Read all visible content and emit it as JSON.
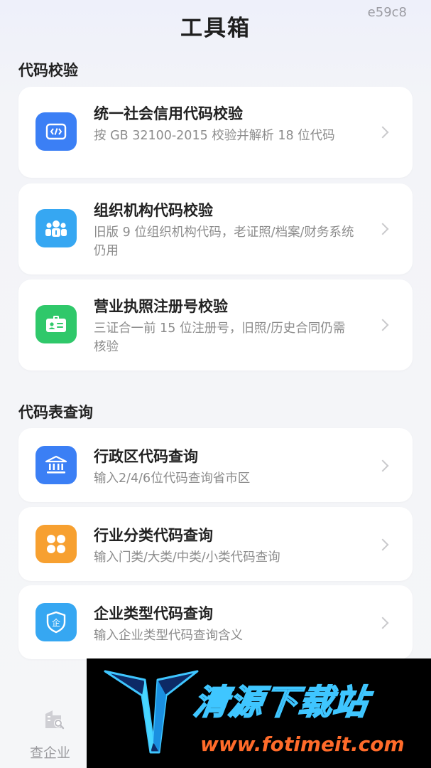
{
  "header": {
    "title": "工具箱",
    "corner_tag": "e59c8"
  },
  "sections": [
    {
      "title": "代码校验",
      "items": [
        {
          "title": "统一社会信用代码校验",
          "desc": "按 GB 32100-2015 校验并解析 18 位代码",
          "icon": "code-icon",
          "color": "#3b7ff5"
        },
        {
          "title": "组织机构代码校验",
          "desc": "旧版 9 位组织机构代码，老证照/档案/财务系统仍用",
          "icon": "people-icon",
          "color": "#36a7f2"
        },
        {
          "title": "营业执照注册号校验",
          "desc": "三证合一前 15 位注册号，旧照/历史合同仍需核验",
          "icon": "id-card-icon",
          "color": "#2fc86a"
        }
      ]
    },
    {
      "title": "代码表查询",
      "items": [
        {
          "title": "行政区代码查询",
          "desc": "输入2/4/6位代码查询省市区",
          "icon": "government-building-icon",
          "color": "#3b7ff5"
        },
        {
          "title": "行业分类代码查询",
          "desc": "输入门类/大类/中类/小类代码查询",
          "icon": "grid-petals-icon",
          "color": "#f7a030"
        },
        {
          "title": "企业类型代码查询",
          "desc": "输入企业类型代码查询含义",
          "icon": "shield-enterprise-icon",
          "color": "#36a7f2"
        }
      ]
    }
  ],
  "bottom_nav": {
    "label": "查企业",
    "icon": "company-search-icon"
  },
  "watermark": {
    "text": "清源下载站",
    "url": "www.fotimeit.com"
  }
}
